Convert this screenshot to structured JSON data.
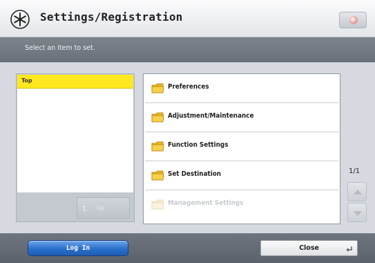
{
  "header": {
    "title": "Settings/Registration",
    "icon": "settings-asterisk-icon",
    "status_icon": "status-monitor-icon"
  },
  "instruction": "Select an item to set.",
  "tree": {
    "top_label": "Top",
    "up_label": "Up",
    "up_icon": "up-arrow-icon"
  },
  "items": [
    {
      "label": "Preferences",
      "enabled": true
    },
    {
      "label": "Adjustment/Maintenance",
      "enabled": true
    },
    {
      "label": "Function Settings",
      "enabled": true
    },
    {
      "label": "Set Destination",
      "enabled": true
    },
    {
      "label": "Management Settings",
      "enabled": false
    }
  ],
  "pagination": {
    "text": "1/1"
  },
  "footer": {
    "login_label": "Log In",
    "close_label": "Close"
  },
  "colors": {
    "selected_bg": "#ffe81f",
    "login_accent": "#2a6fcc",
    "folder": "#f3c93a"
  }
}
